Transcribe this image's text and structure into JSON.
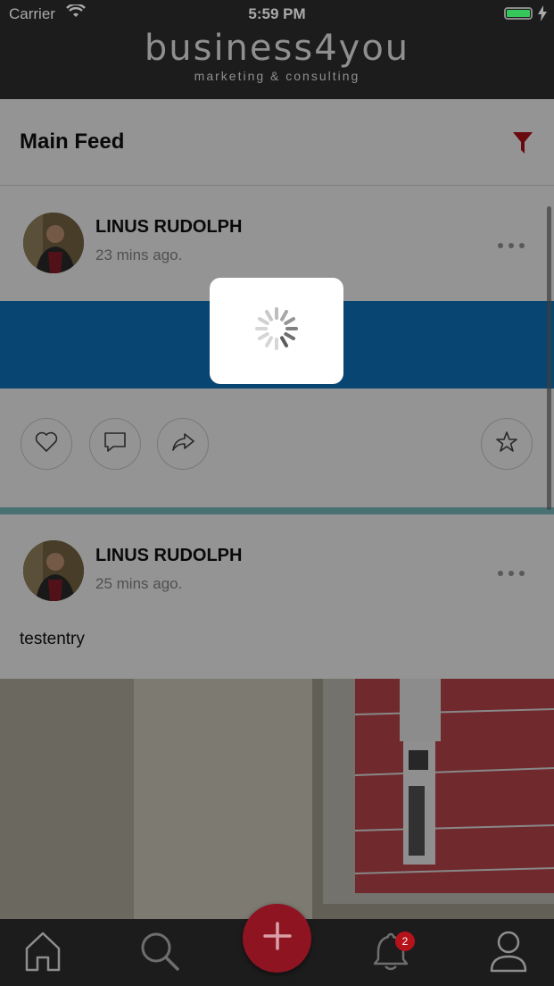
{
  "status_bar": {
    "carrier": "Carrier",
    "time": "5:59 PM"
  },
  "header": {
    "brand_name": "business4you",
    "brand_tagline": "marketing & consulting"
  },
  "feed": {
    "title": "Main Feed",
    "posts": [
      {
        "author": "LINUS RUDOLPH",
        "time": "23 mins ago.",
        "text": ""
      },
      {
        "author": "LINUS RUDOLPH",
        "time": "25 mins ago.",
        "text": "testentry"
      }
    ]
  },
  "tabbar": {
    "notification_count": "2"
  },
  "colors": {
    "accent": "#b5121b",
    "banner": "#0e78c5",
    "header_bg": "#1c1c1c"
  },
  "icons": [
    "wifi-icon",
    "battery-icon",
    "filter-icon",
    "more-icon",
    "heart-icon",
    "comment-icon",
    "share-icon",
    "star-icon",
    "spinner-icon",
    "home-icon",
    "search-icon",
    "plus-icon",
    "bell-icon",
    "user-icon"
  ]
}
